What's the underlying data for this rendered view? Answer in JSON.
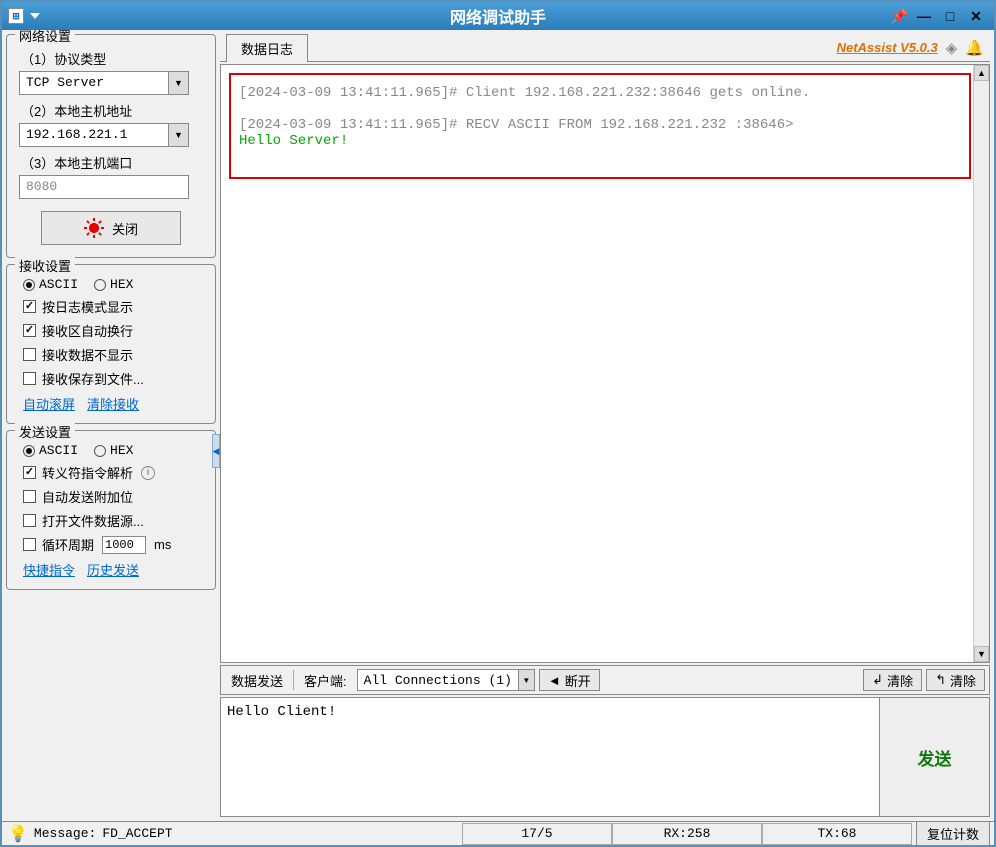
{
  "title": "网络调试助手",
  "brand": "NetAssist V5.0.3",
  "network_settings": {
    "legend": "网络设置",
    "protocol_label": "（1）协议类型",
    "protocol_value": "TCP Server",
    "host_label": "（2）本地主机地址",
    "host_value": "192.168.221.1",
    "port_label": "（3）本地主机端口",
    "port_value": "8080",
    "close_label": "关闭"
  },
  "recv_settings": {
    "legend": "接收设置",
    "ascii": "ASCII",
    "hex": "HEX",
    "log_mode": "按日志模式显示",
    "auto_wrap": "接收区自动换行",
    "hide_recv": "接收数据不显示",
    "save_file": "接收保存到文件...",
    "auto_scroll": "自动滚屏",
    "clear_recv": "清除接收"
  },
  "send_settings": {
    "legend": "发送设置",
    "ascii": "ASCII",
    "hex": "HEX",
    "escape": "转义符指令解析",
    "auto_append": "自动发送附加位",
    "open_file": "打开文件数据源...",
    "cycle_label": "循环周期",
    "cycle_value": "1000",
    "cycle_unit": "ms",
    "quick_cmd": "快捷指令",
    "history": "历史发送"
  },
  "log_tab": "数据日志",
  "log": {
    "line1": "[2024-03-09 13:41:11.965]# Client 192.168.221.232:38646 gets online.",
    "line2": "[2024-03-09 13:41:11.965]# RECV ASCII FROM 192.168.221.232 :38646>",
    "line3": "Hello Server!"
  },
  "send_bar": {
    "data_send": "数据发送",
    "client": "客户端:",
    "connections": "All Connections (1)",
    "disconnect": "断开",
    "clear1": "清除",
    "clear2": "清除"
  },
  "send_text": "Hello Client!",
  "send_btn": "发送",
  "status": {
    "msg_label": "Message:",
    "msg_value": "FD_ACCEPT",
    "counter1": "17/5",
    "rx": "RX:258",
    "tx": "TX:68",
    "reset": "复位计数"
  }
}
